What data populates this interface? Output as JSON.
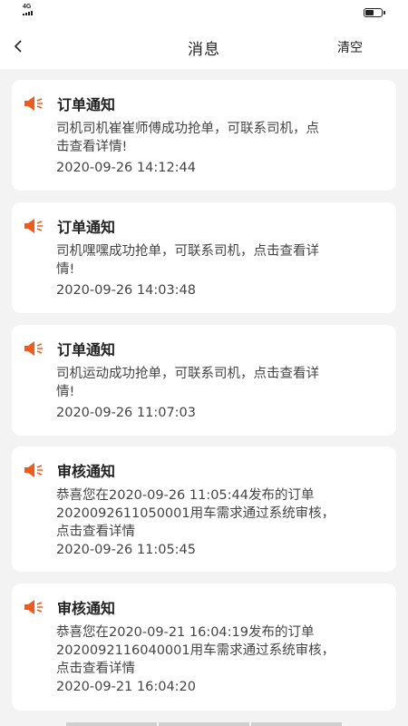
{
  "status_bar": {
    "network": "4G"
  },
  "nav": {
    "back_icon": "chevron-left-icon",
    "title": "消息",
    "clear_label": "清空"
  },
  "colors": {
    "accent": "#f25a1c",
    "background": "#f3f3f3",
    "card": "#ffffff"
  },
  "messages": [
    {
      "icon": "speaker-icon",
      "title": "订单通知",
      "body_lines": [
        "司机司机崔崔师傅成功抢单，可联系司机，点",
        "击查看详情!"
      ],
      "time": "2020-09-26 14:12:44"
    },
    {
      "icon": "speaker-icon",
      "title": "订单通知",
      "body_lines": [
        "司机嘿嘿成功抢单，可联系司机，点击查看详",
        "情!"
      ],
      "time": "2020-09-26 14:03:48"
    },
    {
      "icon": "speaker-icon",
      "title": "订单通知",
      "body_lines": [
        "司机运动成功抢单，可联系司机，点击查看详",
        "情!"
      ],
      "time": "2020-09-26 11:07:03"
    },
    {
      "icon": "speaker-icon",
      "title": "审核通知",
      "body_lines": [
        "恭喜您在2020-09-26 11:05:44发布的订单",
        "2020092611050001用车需求通过系统审核，",
        "点击查看详情"
      ],
      "time": "2020-09-26 11:05:45"
    },
    {
      "icon": "speaker-icon",
      "title": "审核通知",
      "body_lines": [
        "恭喜您在2020-09-21 16:04:19发布的订单",
        "2020092116040001用车需求通过系统审核，",
        "点击查看详情"
      ],
      "time": "2020-09-21 16:04:20"
    }
  ]
}
